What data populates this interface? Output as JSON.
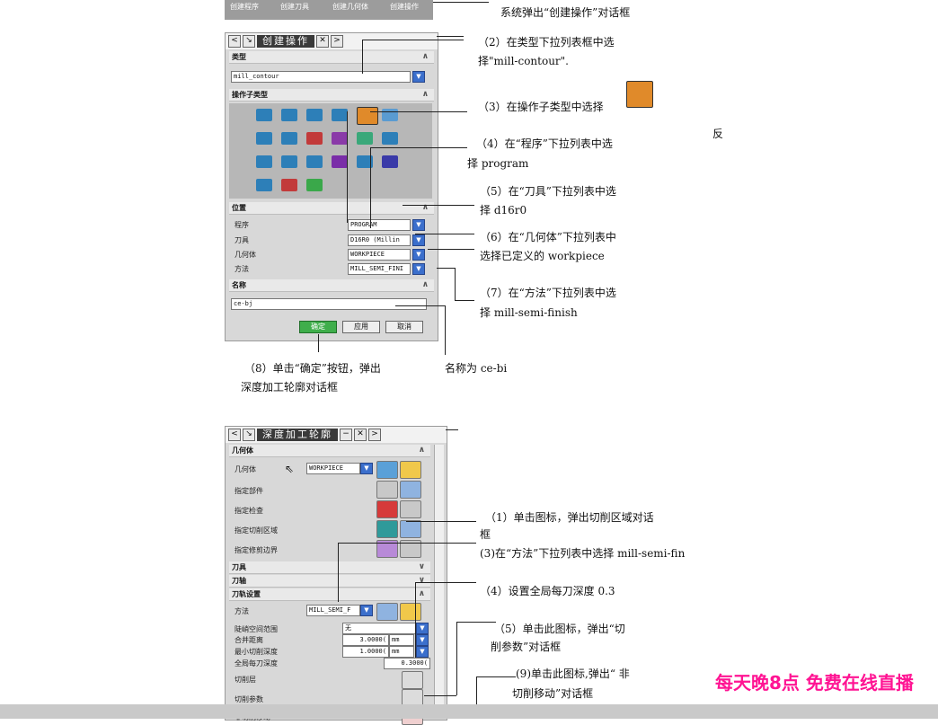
{
  "top_strip": {
    "toolbar_labels": [
      "创建程序",
      "创建刀具",
      "创建几何体",
      "创建操作"
    ],
    "note": "系统弹出“创建操作”对话框"
  },
  "dialog1": {
    "title": "创建操作",
    "type_section": "类型",
    "type_value": "mill_contour",
    "subtype_section": "操作子类型",
    "position_section": "位置",
    "rows": [
      {
        "label": "程序",
        "value": "PROGRAM"
      },
      {
        "label": "刀具",
        "value": "D16R0 (Millin"
      },
      {
        "label": "几何体",
        "value": "WORKPIECE"
      },
      {
        "label": "方法",
        "value": "MILL_SEMI_FINI"
      }
    ],
    "name_section": "名称",
    "name_value": "ce-bj",
    "ok_label": "确定",
    "apply_label": "应用",
    "cancel_label": "取消"
  },
  "annotations1": {
    "a2_line1": "（2）在类型下拉列表框中选",
    "a2_line2": "择\"mill-contour\".",
    "a3": "（3）在操作子类型中选择",
    "a4_line1": "（4）在“程序”下拉列表中选",
    "a4_line2": "择 program",
    "a5_line1": "（5）在“刀具”下拉列表中选",
    "a5_line2": "择 d16r0",
    "a6_line1": "（6）在“几何体”下拉列表中",
    "a6_line2": "选择已定义的 workpiece",
    "a7_line1": "（7）在“方法”下拉列表中选",
    "a7_line2": "择 mill-semi-finish",
    "a8_line1": "（8）单击“确定”按钮，弹出",
    "a8_line2": "深度加工轮廓对话框",
    "name_note": "名称为 ce-bi",
    "stray_char": "反"
  },
  "dialog2": {
    "title": "深度加工轮廓",
    "geometry_section": "几何体",
    "geometry_label": "几何体",
    "geometry_value": "WORKPIECE",
    "specify_part": "指定部件",
    "specify_check": "指定检查",
    "specify_cut_area": "指定切削区域",
    "specify_trim": "指定修剪边界",
    "tool_section": "刀具",
    "axis_section": "刀轴",
    "toolpath_section": "刀轨设置",
    "method_label": "方法",
    "method_value": "MILL_SEMI_F",
    "steep_label": "陡峭空间范围",
    "steep_value": "无",
    "merge_label": "合并距离",
    "merge_value": "3.0000(",
    "merge_unit": "mm",
    "min_cut_label": "最小切削深度",
    "min_cut_value": "1.0000(",
    "min_cut_unit": "mm",
    "depth_label": "全局每刀深度",
    "depth_value": "0.3000(",
    "cut_levels": "切削层",
    "cut_params": "切削参数",
    "non_cut": "非切削移动"
  },
  "annotations2": {
    "b1_line1": "（1）单击图标，弹出切削区域对话",
    "b1_line2": "框",
    "b3": "(3)在“方法”下拉列表中选择 mill-semi-fin",
    "b4": "（4）设置全局每刀深度 0.3",
    "b5_line1": "（5）单击此图标，弹出“切",
    "b5_line2": "削参数”对话框",
    "b9_line1": "(9)单击此图标,弹出“ 非",
    "b9_line2": "切削移动”对话框"
  },
  "banner": "每天晚8点 免费在线直播",
  "colors": {
    "accent": "#3b6fcc",
    "ok": "#3fae4b",
    "banner": "#ff1493"
  }
}
